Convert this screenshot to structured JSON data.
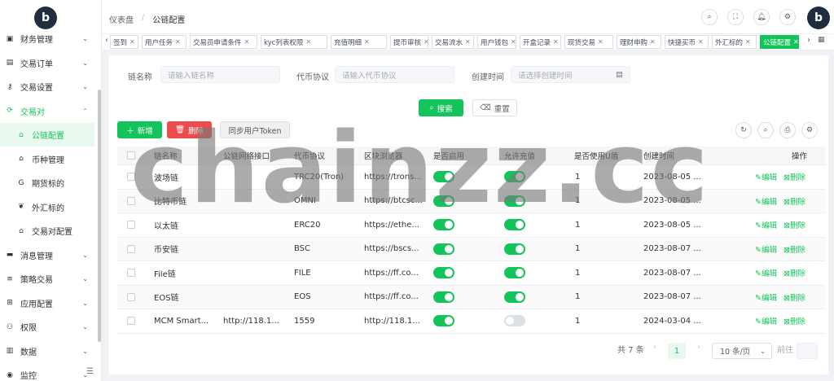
{
  "sidebar": {
    "items": [
      {
        "label": "财务管理",
        "icon": "wallet-icon",
        "level": 1,
        "state": "collapsed"
      },
      {
        "label": "交易订单",
        "icon": "list-icon",
        "level": 1,
        "state": "collapsed"
      },
      {
        "label": "交易设置",
        "icon": "key-icon",
        "level": 1,
        "state": "collapsed"
      },
      {
        "label": "交易对",
        "icon": "exchange-icon",
        "level": 1,
        "state": "open"
      },
      {
        "label": "公链配置",
        "icon": "home-icon",
        "level": 2,
        "state": "active"
      },
      {
        "label": "币种管理",
        "icon": "home-icon",
        "level": 2,
        "state": ""
      },
      {
        "label": "期货标的",
        "icon": "g-icon",
        "level": 2,
        "state": ""
      },
      {
        "label": "外汇标的",
        "icon": "leaf-icon",
        "level": 2,
        "state": ""
      },
      {
        "label": "交易对配置",
        "icon": "home-icon",
        "level": 2,
        "state": ""
      },
      {
        "label": "消息管理",
        "icon": "message-icon",
        "level": 1,
        "state": "collapsed"
      },
      {
        "label": "策略交易",
        "icon": "menu-icon",
        "level": 1,
        "state": "collapsed"
      },
      {
        "label": "应用配置",
        "icon": "app-icon",
        "level": 1,
        "state": "collapsed"
      },
      {
        "label": "权限",
        "icon": "user-key-icon",
        "level": 1,
        "state": "collapsed"
      },
      {
        "label": "数据",
        "icon": "data-icon",
        "level": 1,
        "state": "collapsed"
      },
      {
        "label": "监控",
        "icon": "monitor-icon",
        "level": 1,
        "state": "collapsed"
      }
    ]
  },
  "header": {
    "breadcrumb": [
      "仪表盘",
      "公链配置"
    ],
    "separator": "/"
  },
  "tags": [
    {
      "label": "签到",
      "active": false
    },
    {
      "label": "用户任务",
      "active": false
    },
    {
      "label": "交易员申请条件",
      "active": false
    },
    {
      "label": "kyc列表权限",
      "active": false
    },
    {
      "label": "充值明细",
      "active": false
    },
    {
      "label": "提币审核",
      "active": false
    },
    {
      "label": "交易流水",
      "active": false
    },
    {
      "label": "用户钱包",
      "active": false
    },
    {
      "label": "开盒记录",
      "active": false
    },
    {
      "label": "现货交易",
      "active": false
    },
    {
      "label": "理财申购",
      "active": false
    },
    {
      "label": "快捷买币",
      "active": false
    },
    {
      "label": "外汇标的",
      "active": false
    },
    {
      "label": "公链配置",
      "active": true
    }
  ],
  "filters": {
    "chain_name_label": "链名称",
    "chain_name_placeholder": "请输入链名称",
    "protocol_label": "代币协议",
    "protocol_placeholder": "请输入代币协议",
    "time_label": "创建时间",
    "time_placeholder": "请选择创建时间",
    "search_button": "搜索",
    "reset_button": "重置"
  },
  "toolbar": {
    "add_button": "新增",
    "delete_button": "删除",
    "sync_button": "同步用户Token"
  },
  "table": {
    "columns": [
      "链名称",
      "公链网络接口",
      "代币协议",
      "区块浏览器",
      "是否启用",
      "允许充值",
      "是否使用U盾",
      "创建时间",
      "操作"
    ],
    "edit_label": "编辑",
    "delete_label": "删除",
    "rows": [
      {
        "name": "波场链",
        "api": "",
        "protocol": "TRC20(Tron)",
        "explorer": "https://trons...",
        "enabled": true,
        "deposit": true,
        "ushield": "1",
        "created": "2023-08-05 ..."
      },
      {
        "name": "比特币链",
        "api": "",
        "protocol": "OMNI",
        "explorer": "https://btcsc...",
        "enabled": true,
        "deposit": true,
        "ushield": "1",
        "created": "2023-08-05 ..."
      },
      {
        "name": "以太链",
        "api": "",
        "protocol": "ERC20",
        "explorer": "https://ethe...",
        "enabled": true,
        "deposit": true,
        "ushield": "1",
        "created": "2023-08-05 ..."
      },
      {
        "name": "币安链",
        "api": "",
        "protocol": "BSC",
        "explorer": "https://bscs...",
        "enabled": true,
        "deposit": true,
        "ushield": "1",
        "created": "2023-08-07 ..."
      },
      {
        "name": "File链",
        "api": "",
        "protocol": "FILE",
        "explorer": "https://ff.co...",
        "enabled": true,
        "deposit": true,
        "ushield": "1",
        "created": "2023-08-07 ..."
      },
      {
        "name": "EOS链",
        "api": "",
        "protocol": "EOS",
        "explorer": "https://ff.co...",
        "enabled": true,
        "deposit": true,
        "ushield": "1",
        "created": "2023-08-07 ..."
      },
      {
        "name": "MCM Smart...",
        "api": "http://118.1...",
        "protocol": "1559",
        "explorer": "http://118.1...",
        "enabled": true,
        "deposit": false,
        "ushield": "1",
        "created": "2024-03-04 ..."
      }
    ]
  },
  "pagination": {
    "total": "共 7 条",
    "current_page": "1",
    "page_size": "10 条/页",
    "jump_label": "前往"
  },
  "watermark": "chainzz.cc",
  "colors": {
    "accent": "#13c45a",
    "danger": "#ef4b4b"
  }
}
